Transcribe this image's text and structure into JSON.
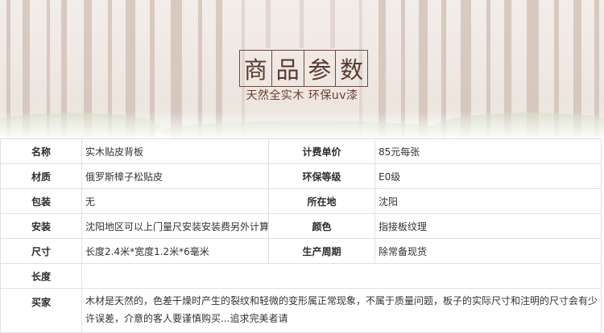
{
  "banner": {
    "title_chars": [
      "商",
      "品",
      "参",
      "数"
    ],
    "subtitle": "天然全实木  环保uv漆",
    "colors": {
      "title": "#5a3a30",
      "subtitle": "#6b3e32",
      "trunk": "#cdbcb0"
    }
  },
  "spec": {
    "rows": [
      {
        "label1": "名称",
        "value1": "实木贴皮背板",
        "label2": "计费单价",
        "value2": "85元每张"
      },
      {
        "label1": "材质",
        "value1": "俄罗斯樟子松贴皮",
        "label2": "环保等级",
        "value2": "E0级"
      },
      {
        "label1": "包装",
        "value1": "无",
        "label2": "所在地",
        "value2": "沈阳"
      },
      {
        "label1": "安装",
        "value1": "沈阳地区可以上门量尺安装安装费另外计算",
        "label2": "颜色",
        "value2": "指接板纹理"
      },
      {
        "label1": "尺寸",
        "value1": "长度2.4米*宽度1.2米*6毫米",
        "label2": "生产周期",
        "value2": "除常备现货"
      }
    ],
    "length_label": "长度",
    "length_value": "",
    "notice_label": "买家",
    "notice_text": "木材是天然的，色差干燥时产生的裂纹和轻微的变形属正常现象，不属于质量问题，板子的实际尺寸和注明的尺寸会有少许误差，介意的客人要谨慎购买...追求完美者请"
  }
}
